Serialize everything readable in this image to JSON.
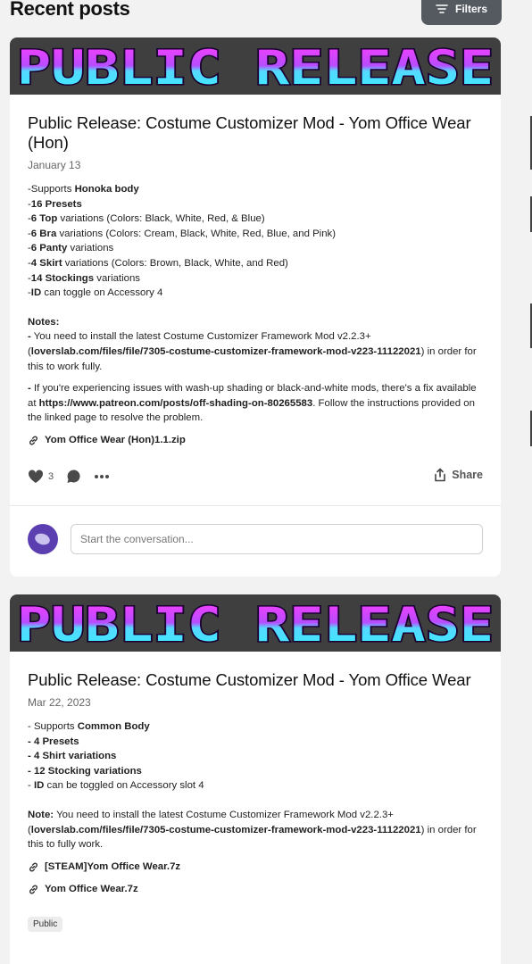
{
  "header": {
    "title": "Recent posts",
    "filters_label": "Filters"
  },
  "posts": [
    {
      "banner_text": "PUBLIC RELEASE",
      "title": "Public Release: Costume Customizer Mod - Yom Office Wear (Hon)",
      "date": "January 13",
      "lines": [
        {
          "pre": "-Supports ",
          "bold": "Honoka body",
          "post": ""
        },
        {
          "pre": "-",
          "bold": "16 Presets",
          "post": ""
        },
        {
          "pre": "-",
          "bold": "6 Top",
          "post": " variations (Colors: Black, White, Red, & Blue)"
        },
        {
          "pre": "-",
          "bold": "6 Bra",
          "post": " variations (Colors: Cream, Black, White, Red, Blue, and Pink)"
        },
        {
          "pre": "-",
          "bold": "6 Panty",
          "post": " variations"
        },
        {
          "pre": "-",
          "bold": "4 Skirt",
          "post": " variations (Colors: Brown, Black, White, and Red)"
        },
        {
          "pre": "-",
          "bold": "14 Stockings",
          "post": " variations"
        },
        {
          "pre": "-",
          "bold": "ID",
          "post": " can toggle on Accessory 4"
        }
      ],
      "notes_label": "Notes:",
      "note1_dash": "-",
      "note1_text": " You need to install the latest Costume Customizer Framework Mod v2.2.3+ (",
      "note1_link": "loverslab.com/files/file/7305-costume-customizer-framework-mod-v223-11122021",
      "note1_end": ") in order for this to work fully.",
      "note2_dash": "-",
      "note2_text": " If you're experiencing issues with wash-up shading or black-and-white mods, there's a fix available at ",
      "note2_link": "https://www.patreon.com/posts/off-shading-on-80265583",
      "note2_end": ". Follow the instructions provided on the linked page to resolve the problem.",
      "attachments": [
        "Yom Office Wear (Hon)1.1.zip"
      ],
      "likes": "3",
      "share_label": "Share",
      "comment_placeholder": "Start the conversation..."
    },
    {
      "banner_text": "PUBLIC RELEASE",
      "title": "Public Release: Costume Customizer Mod - Yom Office Wear",
      "date": "Mar 22, 2023",
      "lines": [
        {
          "pre": "- Supports ",
          "bold": "Common Body",
          "post": ""
        },
        {
          "pre": "",
          "bold": "- 4 Presets",
          "post": ""
        },
        {
          "pre": "",
          "bold": "- 4 Shirt variations",
          "post": ""
        },
        {
          "pre": "",
          "bold": "- 12 Stocking variations",
          "post": ""
        },
        {
          "pre": "- ",
          "bold": "ID",
          "post": " can be toggled on Accessory slot 4"
        }
      ],
      "note_label": "Note:",
      "note_text": " You need to install the latest Costume Customizer Framework Mod v2.2.3+ (",
      "note_link": "loverslab.com/files/file/7305-costume-customizer-framework-mod-v223-11122021",
      "note_end": ") in order for this to fully work.",
      "attachments": [
        "[STEAM]Yom Office Wear.7z",
        "Yom Office Wear.7z"
      ],
      "tag": "Public"
    }
  ],
  "colors": {
    "banner_bg": "#3f3f3f",
    "banner_text_top": "#e040ff",
    "banner_text_bottom": "#40e0ff",
    "avatar": "#5b3fb0",
    "filters_bg": "#555a61"
  },
  "icons": [
    "filter-icon",
    "heart-icon",
    "comment-icon",
    "more-icon",
    "share-icon",
    "link-icon"
  ]
}
